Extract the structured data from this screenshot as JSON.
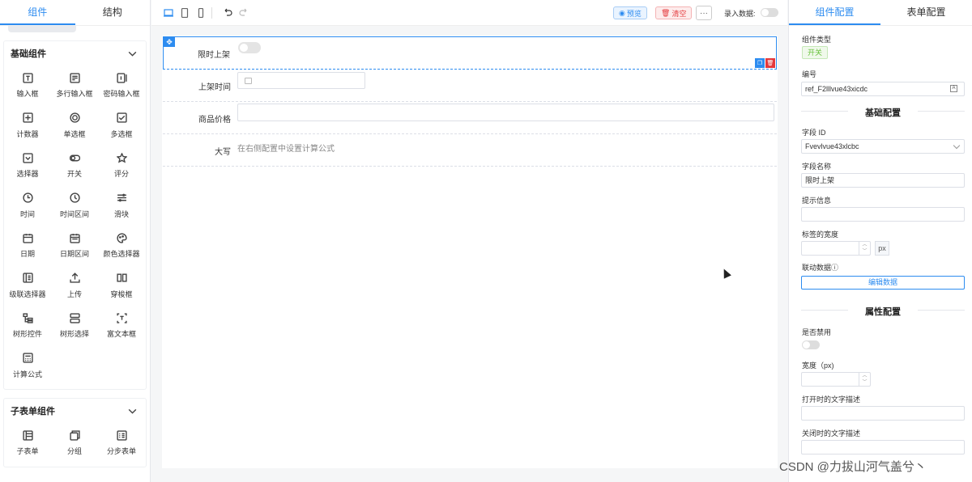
{
  "left": {
    "tabs": [
      "组件",
      "结构"
    ],
    "basic": {
      "title": "基础组件",
      "items": [
        {
          "label": "输入框",
          "icon": "input-icon"
        },
        {
          "label": "多行输入框",
          "icon": "textarea-icon"
        },
        {
          "label": "密码输入框",
          "icon": "password-icon"
        },
        {
          "label": "计数器",
          "icon": "counter-icon"
        },
        {
          "label": "单选框",
          "icon": "radio-icon"
        },
        {
          "label": "多选框",
          "icon": "checkbox-icon"
        },
        {
          "label": "选择器",
          "icon": "select-icon"
        },
        {
          "label": "开关",
          "icon": "switch-icon"
        },
        {
          "label": "评分",
          "icon": "star-icon"
        },
        {
          "label": "时间",
          "icon": "clock-icon"
        },
        {
          "label": "时间区间",
          "icon": "clock-range-icon"
        },
        {
          "label": "滑块",
          "icon": "slider-icon"
        },
        {
          "label": "日期",
          "icon": "calendar-icon"
        },
        {
          "label": "日期区间",
          "icon": "calendar-range-icon"
        },
        {
          "label": "颜色选择器",
          "icon": "palette-icon"
        },
        {
          "label": "级联选择器",
          "icon": "cascader-icon"
        },
        {
          "label": "上传",
          "icon": "upload-icon"
        },
        {
          "label": "穿梭框",
          "icon": "transfer-icon"
        },
        {
          "label": "树形控件",
          "icon": "tree-icon"
        },
        {
          "label": "树形选择",
          "icon": "tree-select-icon"
        },
        {
          "label": "富文本框",
          "icon": "rich-text-icon"
        },
        {
          "label": "计算公式",
          "icon": "calculator-icon"
        }
      ]
    },
    "sub": {
      "title": "子表单组件",
      "items": [
        {
          "label": "子表单",
          "icon": "subform-icon"
        },
        {
          "label": "分组",
          "icon": "group-icon"
        },
        {
          "label": "分步表单",
          "icon": "step-form-icon"
        }
      ]
    }
  },
  "toolbar": {
    "preview": "预览",
    "clear": "清空",
    "more": "···",
    "input_data": "录入数据:"
  },
  "canvas": {
    "fields": [
      {
        "label": "限时上架",
        "type": "switch"
      },
      {
        "label": "上架时间",
        "type": "date"
      },
      {
        "label": "商品价格",
        "type": "input"
      },
      {
        "label": "大写",
        "type": "formula",
        "hint": "在右侧配置中设置计算公式"
      }
    ]
  },
  "right": {
    "tabs": [
      "组件配置",
      "表单配置"
    ],
    "component_type_label": "组件类型",
    "component_type": "开关",
    "id_label": "编号",
    "id_value": "ref_F2lllvue43xicdc",
    "basic_section": "基础配置",
    "field_id_label": "字段 ID",
    "field_id_value": "Fvevlvue43xlcbc",
    "field_name_label": "字段名称",
    "field_name_value": "限时上架",
    "hint_label": "提示信息",
    "label_width_label": "标签的宽度",
    "px": "px",
    "linked_data_label": "联动数据ⓘ",
    "edit_data": "编辑数据",
    "attr_section": "属性配置",
    "disabled_label": "是否禁用",
    "width_label": "宽度（px)",
    "open_text_label": "打开时的文字描述",
    "close_text_label": "关闭时的文字描述"
  },
  "watermark": "CSDN @力拔山河气盖兮丶",
  "colors": {
    "accent": "#2d8cf0",
    "danger": "#e4393c",
    "tag": "#67c23a"
  }
}
